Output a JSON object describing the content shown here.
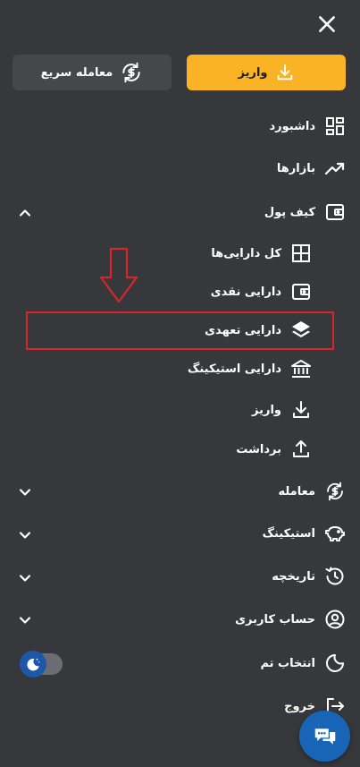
{
  "header": {
    "close_icon": "close-icon"
  },
  "actions": {
    "deposit_label": "واریز",
    "quick_trade_label": "معامله سریع",
    "deposit_color": "#f9b324",
    "quick_trade_color": "#45474b"
  },
  "menu": {
    "dashboard": "داشبورد",
    "markets": "بازارها",
    "wallet": "کیف پول",
    "wallet_items": {
      "all_assets": "کل دارایی‌ها",
      "cash_assets": "دارایی نقدی",
      "committed_assets": "دارایی تعهدی",
      "staking_assets": "دارایی استیکینگ",
      "deposit": "واریز",
      "withdraw": "برداشت"
    },
    "trade": "معامله",
    "staking": "استیکینگ",
    "history": "تاریخچه",
    "account": "حساب کاربری",
    "theme": "انتخاب تم",
    "logout": "خروج"
  },
  "theme_toggle": {
    "state": "dark"
  },
  "colors": {
    "background": "#37383c",
    "accent": "#f9b324",
    "highlight_border": "#d6262a",
    "chat_button": "#1865b8"
  }
}
